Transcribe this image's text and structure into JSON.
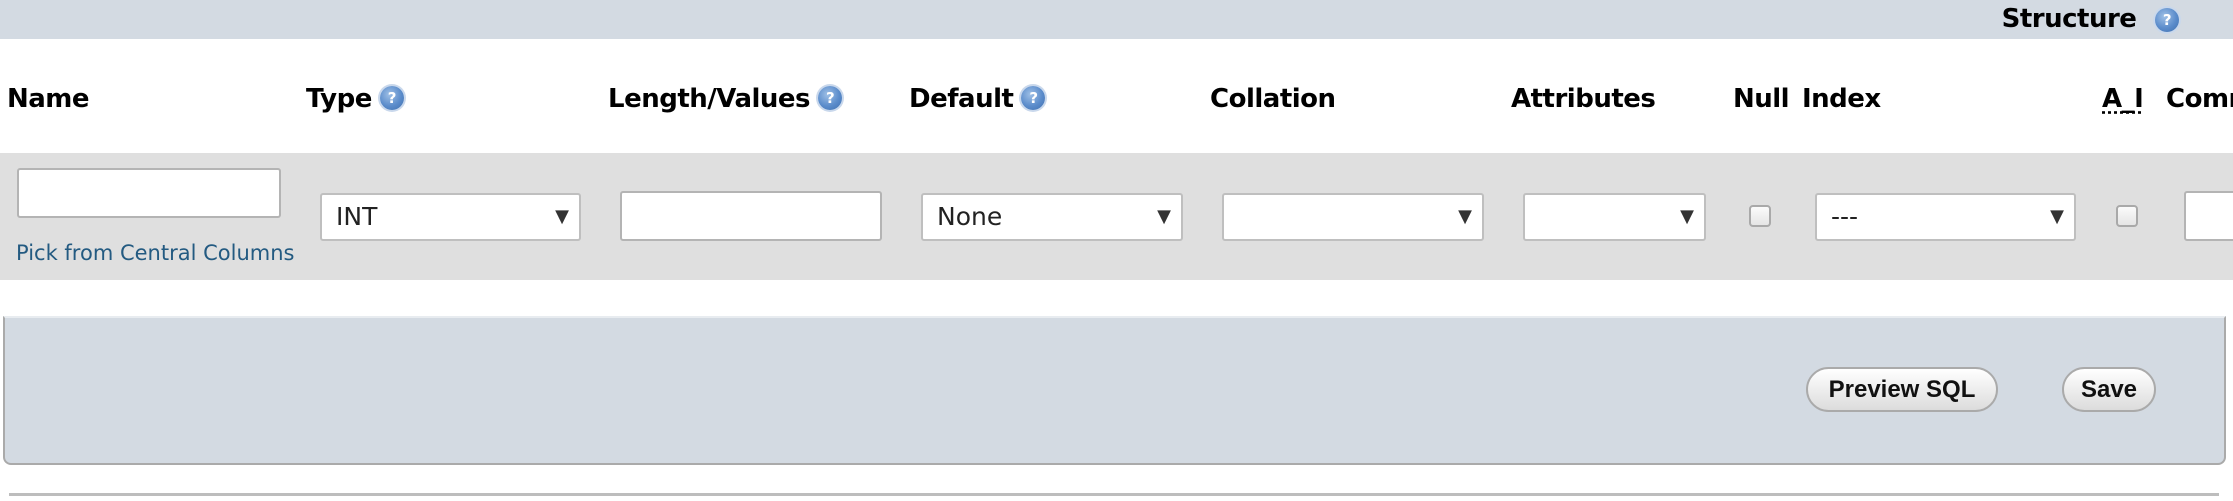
{
  "topbar": {
    "title": "Structure",
    "help_icon": "help-icon"
  },
  "headers": {
    "name": "Name",
    "type": "Type",
    "length_values": "Length/Values",
    "default": "Default",
    "collation": "Collation",
    "attributes": "Attributes",
    "null": "Null",
    "index": "Index",
    "ai": "A_I",
    "comments": "Comm"
  },
  "help_glyph": "?",
  "row": {
    "name_value": "",
    "pick_central_link": "Pick from Central Columns",
    "type_selected": "INT",
    "length_value": "",
    "default_selected": "None",
    "collation_selected": "",
    "attributes_selected": "",
    "null_checked": false,
    "index_selected": "---",
    "ai_checked": false,
    "comment_value": ""
  },
  "dropdown_arrow": "▼",
  "actions": {
    "preview_sql": "Preview SQL",
    "save": "Save"
  }
}
